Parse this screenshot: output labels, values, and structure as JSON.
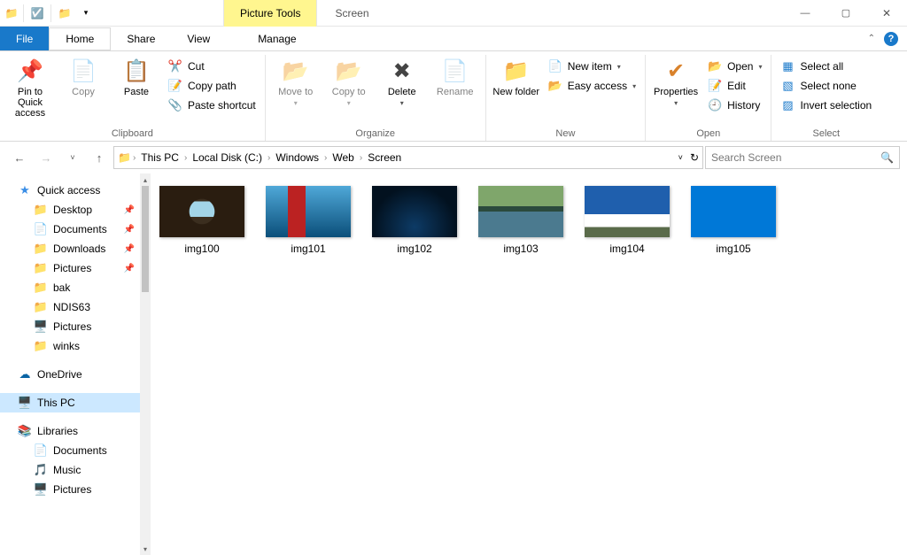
{
  "window": {
    "context_tool": "Picture Tools",
    "title": "Screen"
  },
  "tabs": {
    "file": "File",
    "home": "Home",
    "share": "Share",
    "view": "View",
    "manage": "Manage"
  },
  "ribbon": {
    "clipboard": {
      "label": "Clipboard",
      "pin": "Pin to Quick access",
      "copy": "Copy",
      "paste": "Paste",
      "cut": "Cut",
      "copy_path": "Copy path",
      "paste_shortcut": "Paste shortcut"
    },
    "organize": {
      "label": "Organize",
      "move_to": "Move to",
      "copy_to": "Copy to",
      "delete": "Delete",
      "rename": "Rename"
    },
    "new": {
      "label": "New",
      "new_folder": "New folder",
      "new_item": "New item",
      "easy_access": "Easy access"
    },
    "open": {
      "label": "Open",
      "properties": "Properties",
      "open": "Open",
      "edit": "Edit",
      "history": "History"
    },
    "select": {
      "label": "Select",
      "select_all": "Select all",
      "select_none": "Select none",
      "invert": "Invert selection"
    }
  },
  "breadcrumbs": [
    "This PC",
    "Local Disk (C:)",
    "Windows",
    "Web",
    "Screen"
  ],
  "search": {
    "placeholder": "Search Screen"
  },
  "sidebar": {
    "quick_access": "Quick access",
    "items": [
      {
        "label": "Desktop",
        "pinned": true
      },
      {
        "label": "Documents",
        "pinned": true
      },
      {
        "label": "Downloads",
        "pinned": true
      },
      {
        "label": "Pictures",
        "pinned": true
      },
      {
        "label": "bak",
        "pinned": false
      },
      {
        "label": "NDIS63",
        "pinned": false
      },
      {
        "label": "Pictures",
        "pinned": false
      },
      {
        "label": "winks",
        "pinned": false
      }
    ],
    "onedrive": "OneDrive",
    "this_pc": "This PC",
    "libraries": "Libraries",
    "lib_items": [
      "Documents",
      "Music",
      "Pictures"
    ]
  },
  "files": [
    "img100",
    "img101",
    "img102",
    "img103",
    "img104",
    "img105"
  ]
}
